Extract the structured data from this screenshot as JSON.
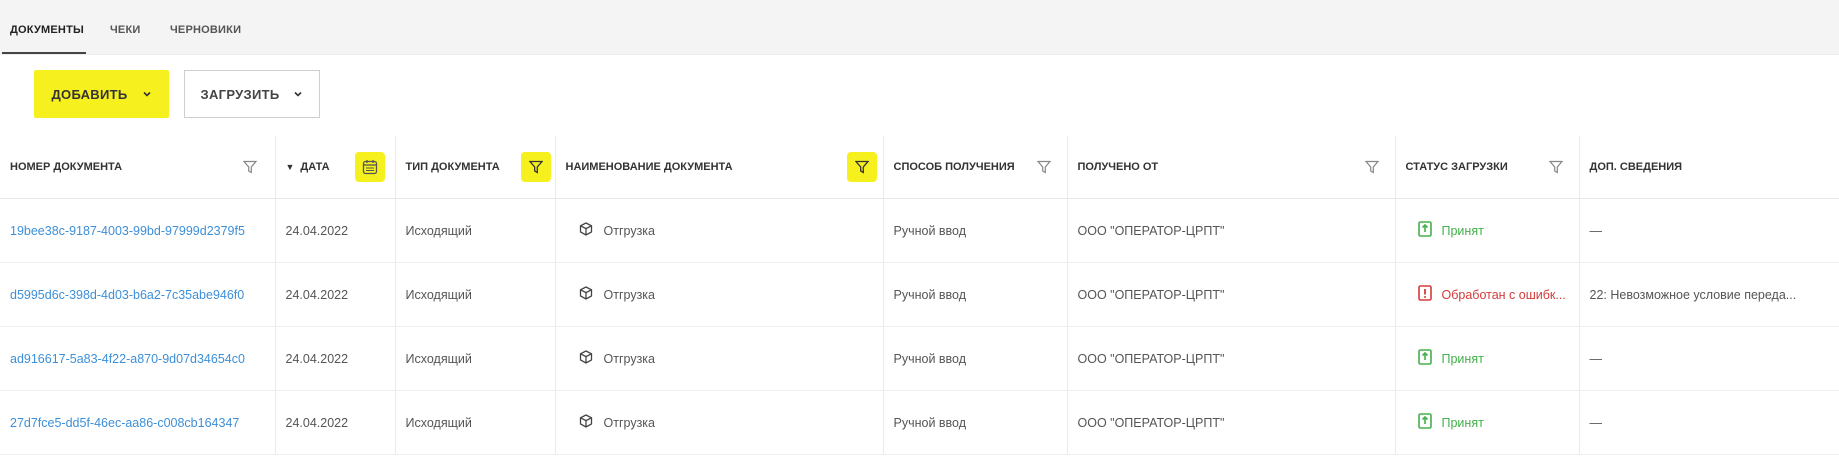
{
  "tabs": [
    {
      "label": "ДОКУМЕНТЫ",
      "active": true
    },
    {
      "label": "ЧЕКИ",
      "active": false
    },
    {
      "label": "ЧЕРНОВИКИ",
      "active": false
    }
  ],
  "toolbar": {
    "add_label": "ДОБАВИТЬ",
    "load_label": "ЗАГРУЗИТЬ"
  },
  "colors": {
    "accent": "#f6f01f",
    "link": "#3d8fd8",
    "ok": "#43b04a",
    "error": "#d33b3b"
  },
  "table": {
    "columns": [
      {
        "label": "НОМЕР ДОКУМЕНТА",
        "filter": "filter-icon",
        "highlighted": false
      },
      {
        "label": "ДАТА",
        "filter": "calendar-icon",
        "highlighted": true,
        "sorted": "desc"
      },
      {
        "label": "ТИП ДОКУМЕНТА",
        "filter": "filter-icon",
        "highlighted": true
      },
      {
        "label": "НАИМЕНОВАНИЕ ДОКУМЕНТА",
        "filter": "filter-icon",
        "highlighted": true
      },
      {
        "label": "СПОСОБ ПОЛУЧЕНИЯ",
        "filter": "filter-icon",
        "highlighted": false
      },
      {
        "label": "ПОЛУЧЕНО ОТ",
        "filter": "filter-icon",
        "highlighted": false
      },
      {
        "label": "СТАТУС ЗАГРУЗКИ",
        "filter": "filter-icon",
        "highlighted": false
      },
      {
        "label": "ДОП. СВЕДЕНИЯ"
      }
    ],
    "rows": [
      {
        "number": "19bee38c-9187-4003-99bd-97999d2379f5",
        "date": "24.04.2022",
        "type": "Исходящий",
        "name": "Отгрузка",
        "method": "Ручной ввод",
        "from": "ООО \"ОПЕРАТОР-ЦРПТ\"",
        "status": "Принят",
        "status_kind": "ok",
        "extra": "—"
      },
      {
        "number": "d5995d6c-398d-4d03-b6a2-7c35abe946f0",
        "date": "24.04.2022",
        "type": "Исходящий",
        "name": "Отгрузка",
        "method": "Ручной ввод",
        "from": "ООО \"ОПЕРАТОР-ЦРПТ\"",
        "status": "Обработан с ошибк...",
        "status_kind": "error",
        "extra": "22: Невозможное условие переда..."
      },
      {
        "number": "ad916617-5a83-4f22-a870-9d07d34654c0",
        "date": "24.04.2022",
        "type": "Исходящий",
        "name": "Отгрузка",
        "method": "Ручной ввод",
        "from": "ООО \"ОПЕРАТОР-ЦРПТ\"",
        "status": "Принят",
        "status_kind": "ok",
        "extra": "—"
      },
      {
        "number": "27d7fce5-dd5f-46ec-aa86-c008cb164347",
        "date": "24.04.2022",
        "type": "Исходящий",
        "name": "Отгрузка",
        "method": "Ручной ввод",
        "from": "ООО \"ОПЕРАТОР-ЦРПТ\"",
        "status": "Принят",
        "status_kind": "ok",
        "extra": "—"
      }
    ]
  }
}
